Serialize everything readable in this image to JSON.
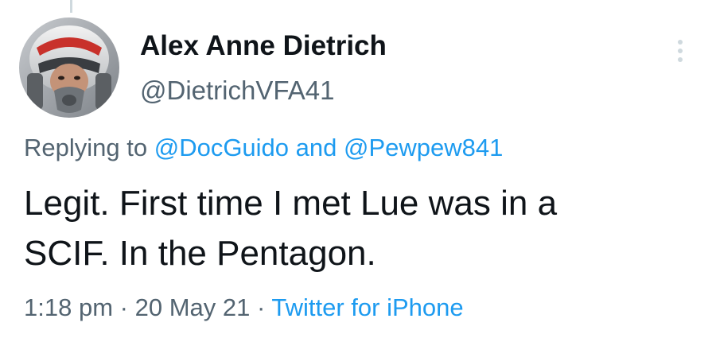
{
  "author": {
    "name": "Alex Anne Dietrich",
    "handle": "@DietrichVFA41"
  },
  "reply": {
    "prefix": "Replying to",
    "mention_1": "@DocGuido",
    "conjunction": "and",
    "mention_2": "@Pewpew841"
  },
  "tweet": {
    "text_line_1": "Legit. First time I met Lue was in a",
    "text_line_2": "SCIF. In the Pentagon."
  },
  "meta": {
    "time": "1:18 pm",
    "separator": "·",
    "date": "20 May 21",
    "source": "Twitter for iPhone"
  },
  "icons": {
    "more": "more-options-vertical-dots-icon",
    "avatar": "pilot-helmet-avatar"
  },
  "colors": {
    "text_primary": "#0f1419",
    "text_secondary": "#536471",
    "link_blue": "#1d9bf0"
  }
}
